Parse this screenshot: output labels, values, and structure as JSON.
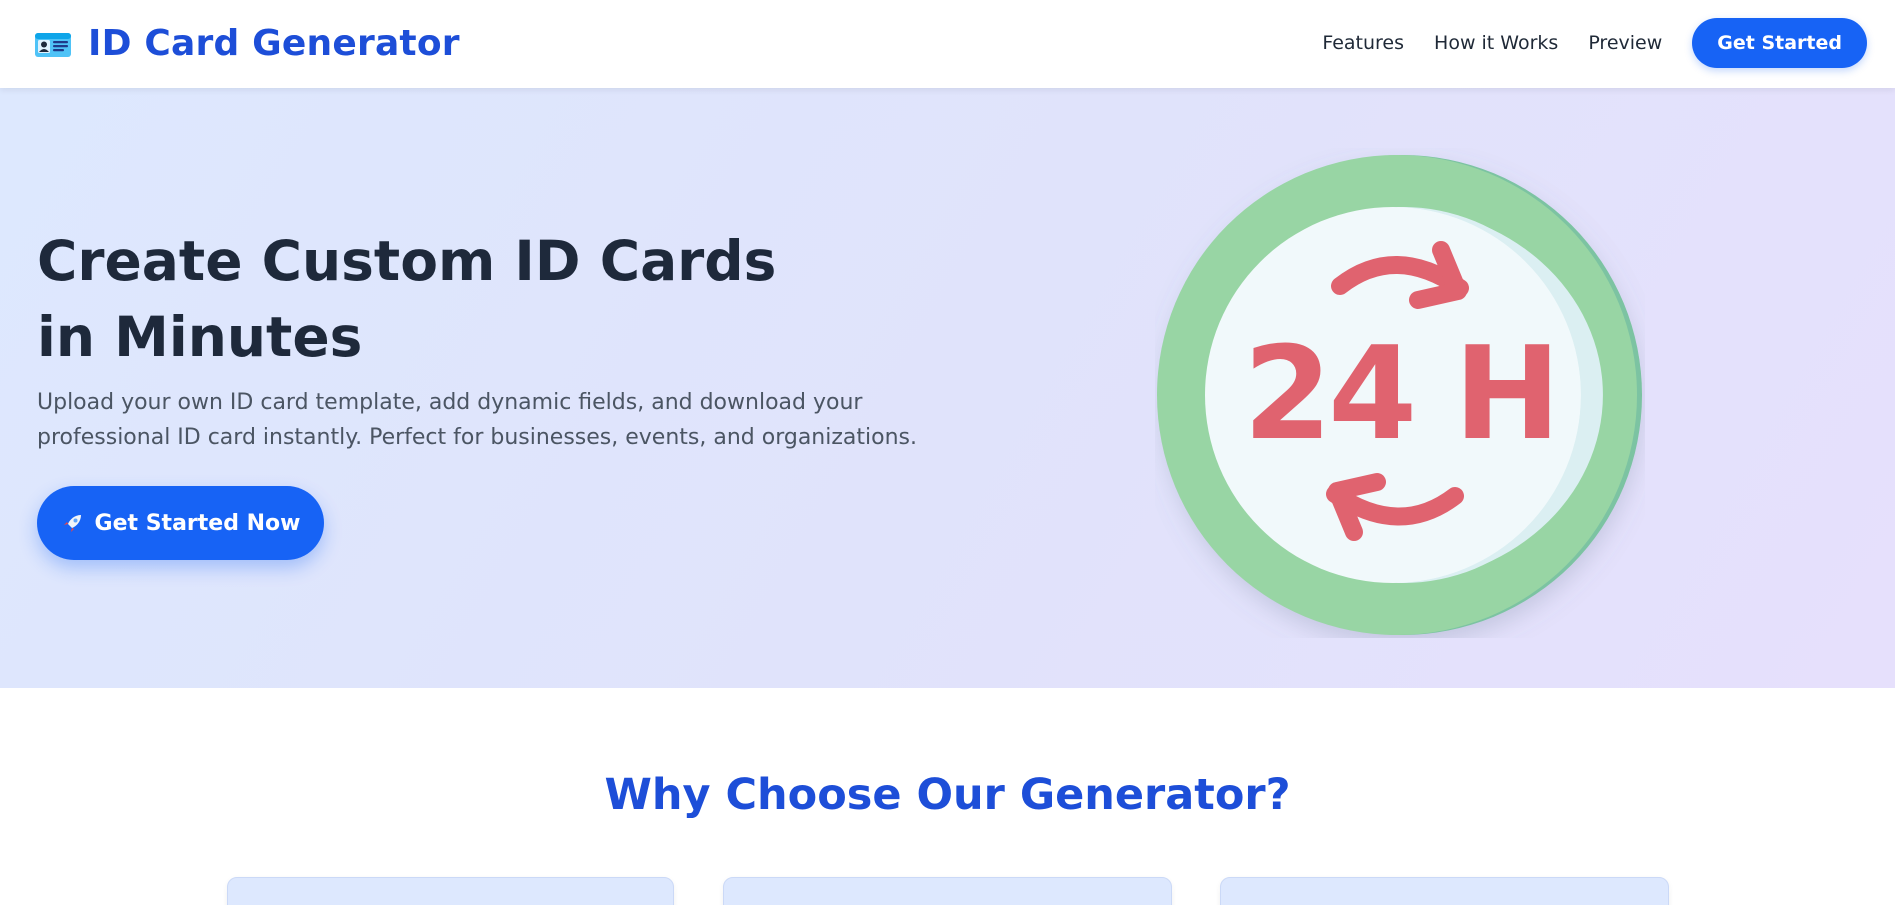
{
  "header": {
    "brand_icon": "id-card-icon",
    "brand_title": "ID Card Generator",
    "nav": [
      {
        "label": "Features"
      },
      {
        "label": "How it Works"
      },
      {
        "label": "Preview"
      }
    ],
    "cta_label": "Get Started"
  },
  "hero": {
    "title_line1": "Create Custom ID Cards",
    "title_line2": "in Minutes",
    "subtitle": "Upload your own ID card template, add dynamic fields, and download your professional ID card instantly. Perfect for businesses, events, and organizations.",
    "cta_icon": "rocket-icon",
    "cta_label": "Get Started Now",
    "badge_icon": "24-hour-icon",
    "badge_text": "24 H"
  },
  "features": {
    "title": "Why Choose Our Generator?",
    "cards": [
      {},
      {},
      {}
    ]
  },
  "colors": {
    "brand": "#1d4ed8",
    "accent": "#1763f5",
    "badge_green": "#98d5a4",
    "badge_red": "#e0636f"
  }
}
